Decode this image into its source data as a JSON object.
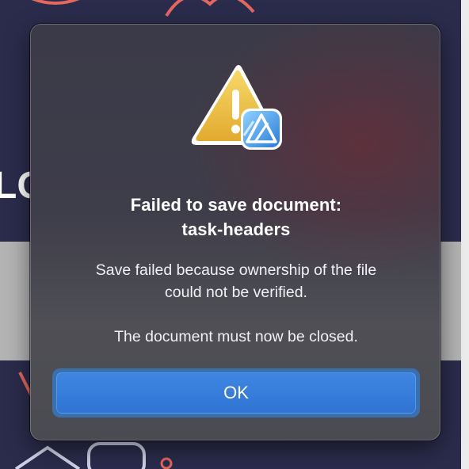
{
  "dialog": {
    "title_line1": "Failed to save document:",
    "title_line2": "task-headers",
    "message_line1": "Save failed because ownership of the file",
    "message_line2": "could not be verified.",
    "message_line3": "The document must now be closed.",
    "ok_label": "OK",
    "icon": "warning-triangle-icon",
    "app_badge_icon": "affinity-designer-icon"
  },
  "colors": {
    "accent_button": "#2f74d3",
    "warning_yellow": "#f2c84b",
    "background_navy": "#2b2c4c"
  }
}
